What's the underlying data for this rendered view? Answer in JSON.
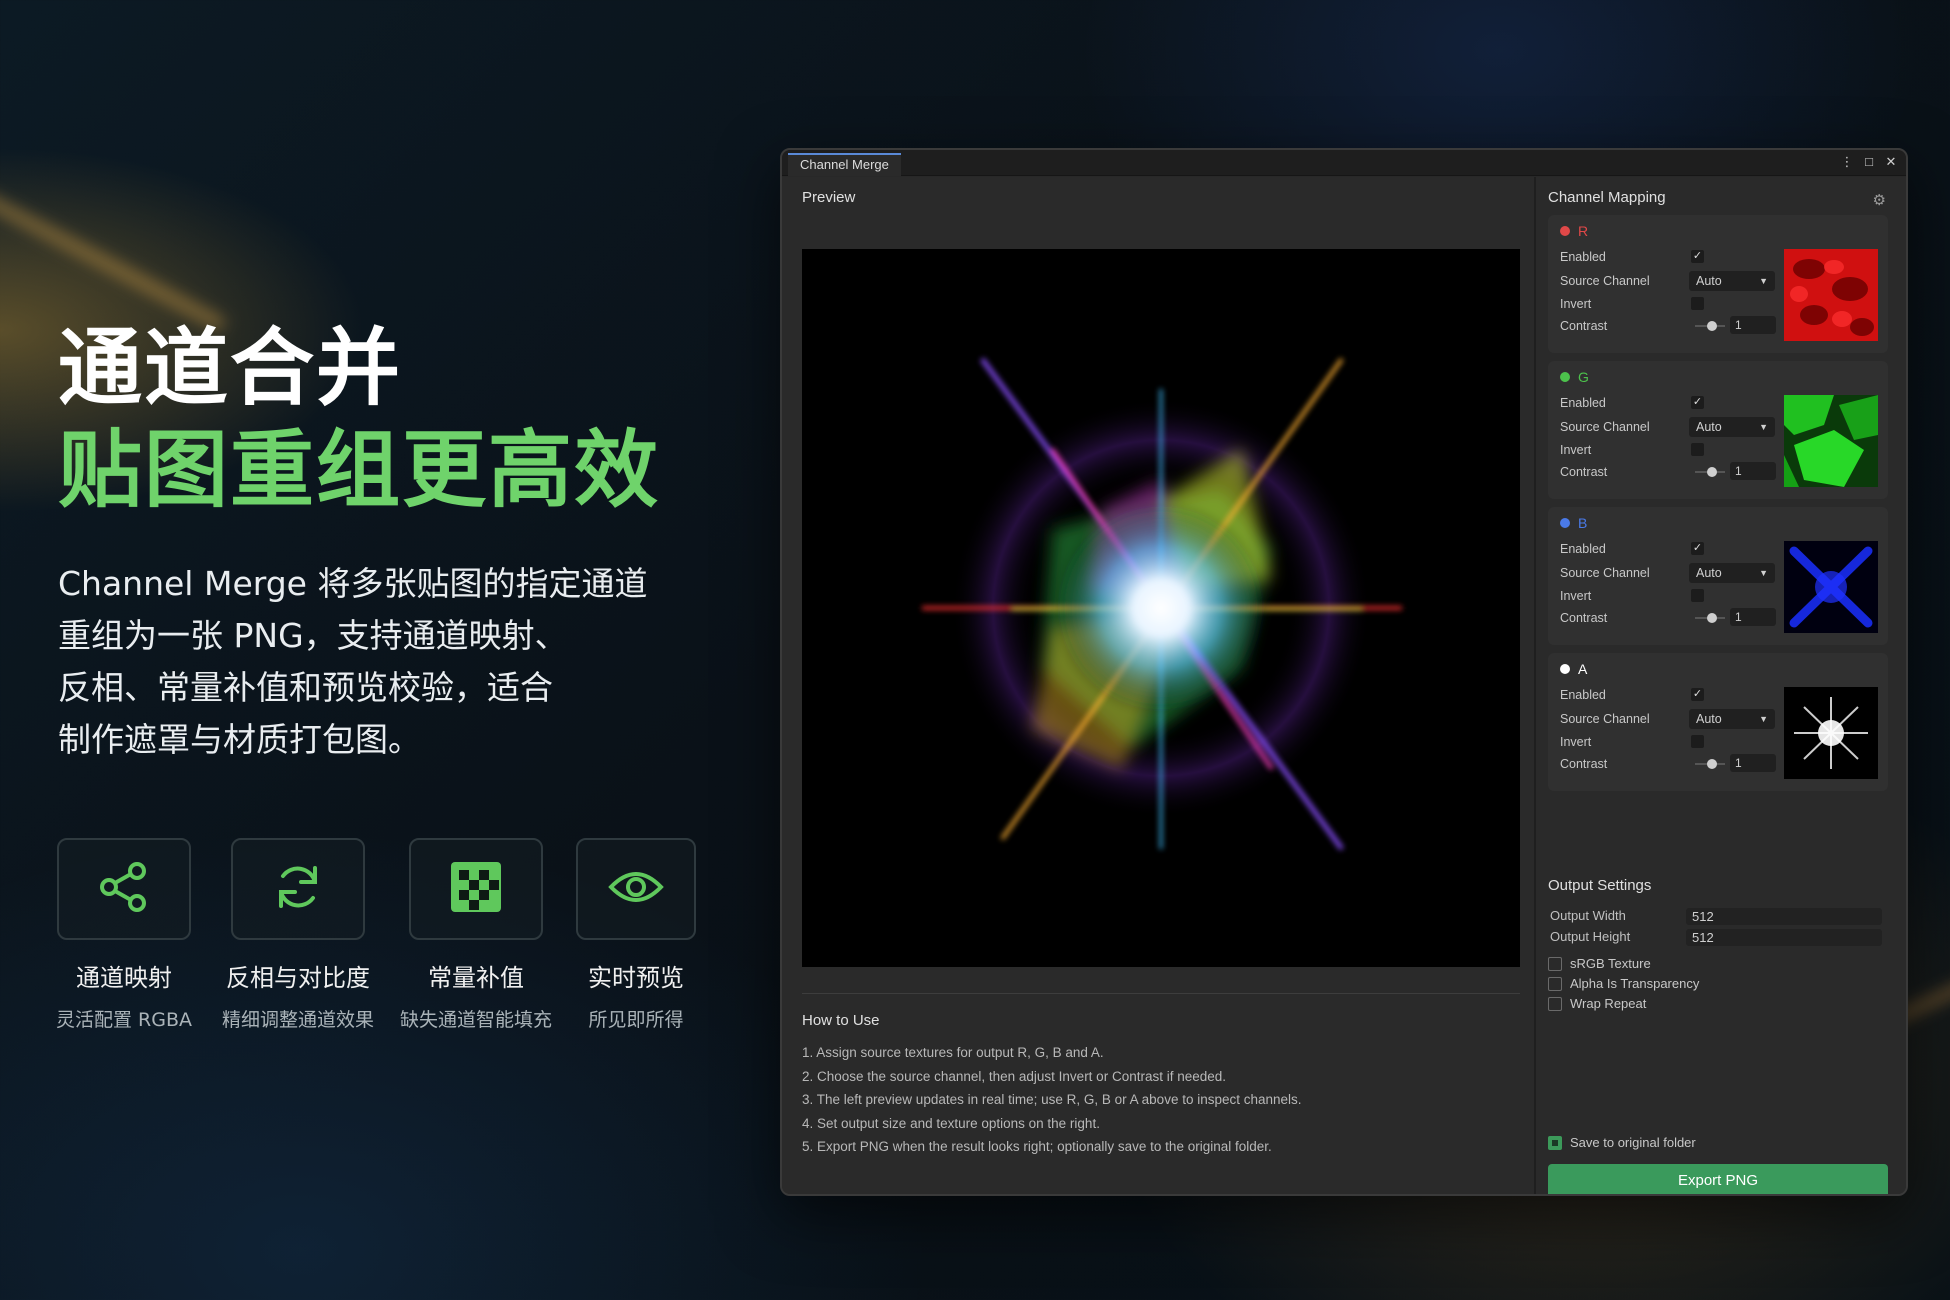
{
  "hero": {
    "title_line1": "通道合并",
    "title_line2": "贴图重组更高效",
    "desc_lines": [
      "Channel Merge 将多张贴图的指定通道",
      "重组为一张 PNG，支持通道映射、",
      "反相、常量补值和预览校验，适合",
      "制作遮罩与材质打包图。"
    ]
  },
  "features": [
    {
      "icon": "share-nodes-icon",
      "name": "通道映射",
      "sub": "灵活配置 RGBA"
    },
    {
      "icon": "refresh-icon",
      "name": "反相与对比度",
      "sub": "精细调整通道效果"
    },
    {
      "icon": "checkerboard-icon",
      "name": "常量补值",
      "sub": "缺失通道智能填充"
    },
    {
      "icon": "eye-icon",
      "name": "实时预览",
      "sub": "所见即所得"
    }
  ],
  "colors": {
    "accent": "#6fd36b",
    "export_button": "#3a9a5c",
    "window_bg": "#282828"
  },
  "window": {
    "tab_label": "Channel Merge",
    "buttons": {
      "menu": "⋮",
      "maximize": "□",
      "close": "✕"
    },
    "preview": {
      "title": "Preview"
    },
    "how_to_use": {
      "title": "How to Use",
      "steps": [
        "1. Assign source textures for output R, G, B and A.",
        "2. Choose the source channel, then adjust Invert or Contrast if needed.",
        "3. The left preview updates in real time; use R, G, B or A above to inspect channels.",
        "4. Set output size and texture options on the right.",
        "5. Export PNG when the result looks right; optionally save to the original folder."
      ]
    },
    "channel_mapping": {
      "title": "Channel Mapping",
      "labels": {
        "enabled": "Enabled",
        "source": "Source Channel",
        "invert": "Invert",
        "contrast": "Contrast"
      },
      "channels": [
        {
          "name": "R",
          "color": "#e04848",
          "enabled": true,
          "source": "Auto",
          "invert": false,
          "contrast": "1"
        },
        {
          "name": "G",
          "color": "#4cc24c",
          "enabled": true,
          "source": "Auto",
          "invert": false,
          "contrast": "1"
        },
        {
          "name": "B",
          "color": "#4a7ae8",
          "enabled": true,
          "source": "Auto",
          "invert": false,
          "contrast": "1"
        },
        {
          "name": "A",
          "color": "#ffffff",
          "enabled": true,
          "source": "Auto",
          "invert": false,
          "contrast": "1"
        }
      ]
    },
    "output_settings": {
      "title": "Output Settings",
      "width_label": "Output Width",
      "width": "512",
      "height_label": "Output Height",
      "height": "512",
      "options": [
        {
          "label": "sRGB Texture",
          "checked": false
        },
        {
          "label": "Alpha Is Transparency",
          "checked": false
        },
        {
          "label": "Wrap Repeat",
          "checked": false
        }
      ],
      "save_to_original": {
        "label": "Save to original folder",
        "checked": true
      },
      "export_label": "Export PNG"
    }
  }
}
